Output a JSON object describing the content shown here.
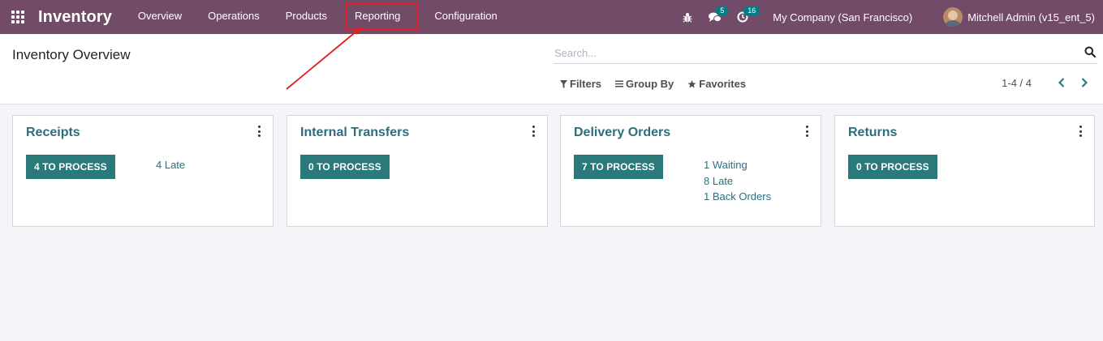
{
  "navbar": {
    "brand": "Inventory",
    "menu": [
      {
        "label": "Overview"
      },
      {
        "label": "Operations"
      },
      {
        "label": "Products"
      },
      {
        "label": "Reporting"
      },
      {
        "label": "Configuration"
      }
    ],
    "messages_badge": "5",
    "activities_badge": "16",
    "company": "My Company (San Francisco)",
    "user": "Mitchell Admin (v15_ent_5)"
  },
  "control_panel": {
    "title": "Inventory Overview",
    "search_placeholder": "Search...",
    "filters_label": "Filters",
    "groupby_label": "Group By",
    "favorites_label": "Favorites",
    "pager_value": "1-4 / 4"
  },
  "cards": [
    {
      "title": "Receipts",
      "button": "4 TO PROCESS",
      "links": [
        "4 Late"
      ]
    },
    {
      "title": "Internal Transfers",
      "button": "0 TO PROCESS",
      "links": []
    },
    {
      "title": "Delivery Orders",
      "button": "7 TO PROCESS",
      "links": [
        "1 Waiting",
        "8 Late",
        "1 Back Orders"
      ]
    },
    {
      "title": "Returns",
      "button": "0 TO PROCESS",
      "links": []
    }
  ],
  "colors": {
    "navbar": "#714b67",
    "accent": "#2a7a7b",
    "link": "#2b6e7e",
    "annotation": "#e31b23"
  }
}
